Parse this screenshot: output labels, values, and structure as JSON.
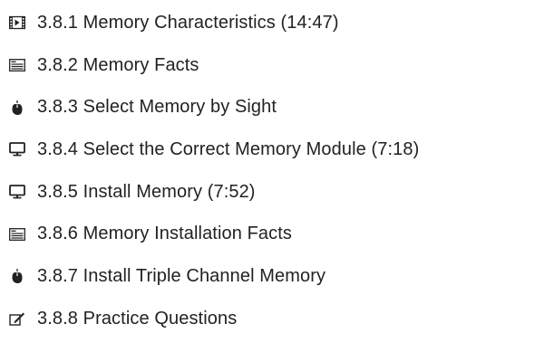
{
  "items": [
    {
      "icon": "video-icon",
      "label": "3.8.1 Memory Characteristics (14:47)"
    },
    {
      "icon": "document-icon",
      "label": "3.8.2 Memory Facts"
    },
    {
      "icon": "mouse-icon",
      "label": "3.8.3 Select Memory by Sight"
    },
    {
      "icon": "monitor-icon",
      "label": "3.8.4 Select the Correct Memory Module (7:18)"
    },
    {
      "icon": "monitor-icon",
      "label": "3.8.5 Install Memory (7:52)"
    },
    {
      "icon": "document-icon",
      "label": "3.8.6 Memory Installation Facts"
    },
    {
      "icon": "mouse-icon",
      "label": "3.8.7 Install Triple Channel Memory"
    },
    {
      "icon": "quiz-icon",
      "label": "3.8.8 Practice Questions"
    }
  ],
  "colors": {
    "icon": "#222222",
    "text": "#222222",
    "background": "#ffffff"
  }
}
